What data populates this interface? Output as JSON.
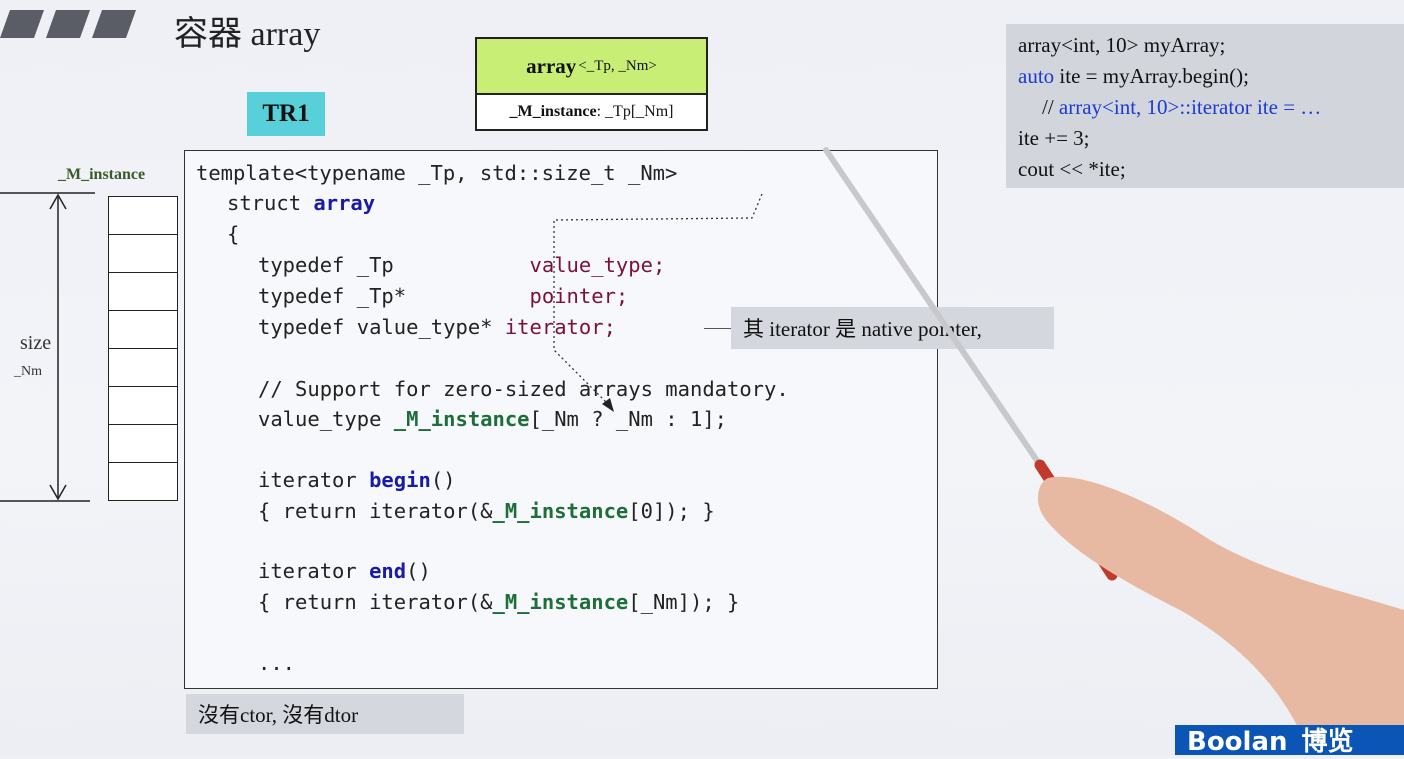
{
  "slide": {
    "title": "容器 array",
    "tr1": "TR1"
  },
  "uml": {
    "class_name": "array",
    "params": "<_Tp, _Nm>",
    "field_name": "_M_instance",
    "field_type": " : _Tp[_Nm]"
  },
  "diagram": {
    "instance_label": "_M_instance",
    "size_label": "size",
    "nm_label": "_Nm"
  },
  "code": {
    "l1": "template<typename _Tp, std::size_t _Nm>",
    "l2_a": "struct ",
    "l2_b": "array",
    "l3": "{",
    "l4_a": "typedef _Tp           ",
    "l4_b": "value_type;",
    "l5_a": "typedef _Tp*          ",
    "l5_b": "pointer;",
    "l6_a": "typedef value_type* ",
    "l6_b": "iterator;",
    "l7": "// Support for zero-sized arrays mandatory.",
    "l8_a": "value_type ",
    "l8_b": "_M_instance",
    "l8_c": "[_Nm ? _Nm : 1];",
    "l9_a": "iterator ",
    "l9_b": "begin",
    "l9_c": "()",
    "l10_a": "{ return iterator(&",
    "l10_b": "_M_instance",
    "l10_c": "[0]); }",
    "l11_a": "iterator ",
    "l11_b": "end",
    "l11_c": "()",
    "l12_a": "{ return iterator(&",
    "l12_b": "_M_instance",
    "l12_c": "[_Nm]); }",
    "l13": "..."
  },
  "notes": {
    "iterator_note": "其 iterator 是 native pointer,",
    "ctor_note": "沒有ctor, 沒有dtor"
  },
  "sample": {
    "s1": "array<int, 10> myArray;",
    "s2_a": "auto",
    "s2_b": " ite = myArray.begin();",
    "s3_a": "// ",
    "s3_b": "array<int, 10>::iterator ite = …",
    "s4": "ite += 3;",
    "s5": "cout << *ite;"
  },
  "brand": {
    "logo": "Boolan",
    "logo_cn": "博览"
  },
  "colors": {
    "tr1_bg": "#58d0da",
    "uml_header": "#c8ee76",
    "keyword_blue": "#1a1aa8",
    "type_maroon": "#7a1040",
    "member_green": "#1e6e3a",
    "note_bg": "#d5d7df",
    "logo_bg": "#0a55b5"
  }
}
